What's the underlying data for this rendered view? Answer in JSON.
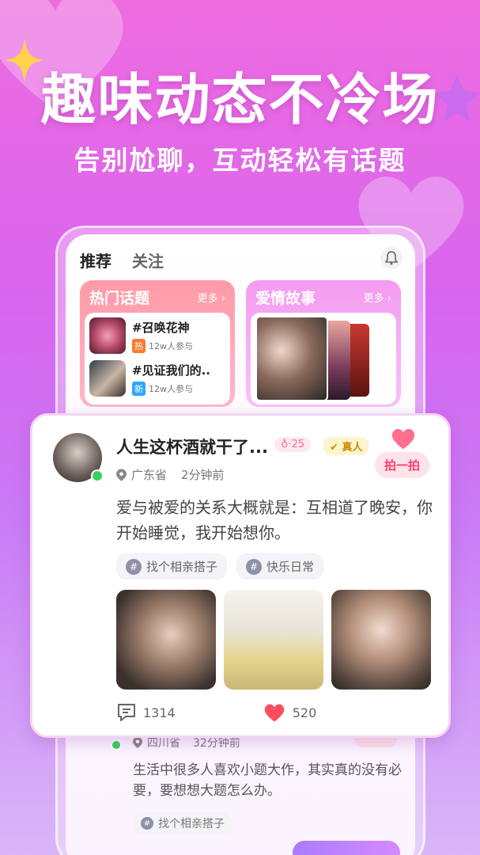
{
  "hero": {
    "headline": "趣味动态不冷场",
    "subline": "告别尬聊，互动轻松有话题"
  },
  "tabs": [
    {
      "label": "推荐",
      "active": true
    },
    {
      "label": "关注",
      "active": false
    }
  ],
  "hot_topics": {
    "title": "热门话题",
    "more": "更多 ›",
    "items": [
      {
        "name": "#召唤花神",
        "badge": "热",
        "participants": "12w人参与"
      },
      {
        "name": "#见证我们的..",
        "badge": "新",
        "participants": "12w人参与"
      }
    ]
  },
  "love_stories": {
    "title": "爱情故事",
    "more": "更多 ›"
  },
  "post": {
    "username": "人生这杯酒就干了...",
    "age": "♁·25",
    "verified": "真人",
    "pat_label": "拍一拍",
    "location": "广东省",
    "time": "2分钟前",
    "text": "爱与被爱的关系大概就是：互相道了晚安，你开始睡觉，我开始想你。",
    "tags": [
      "找个相亲搭子",
      "快乐日常"
    ],
    "comments": "1314",
    "likes": "520"
  },
  "next_post": {
    "location": "四川省",
    "time": "32分钟前",
    "text": "生活中很多人喜欢小题大作，其实真的没有必要，要想想大题怎么办。",
    "tag": "找个相亲搭子"
  },
  "colors": {
    "accent_pink": "#ff3f6b",
    "online_green": "#3ad05a"
  }
}
